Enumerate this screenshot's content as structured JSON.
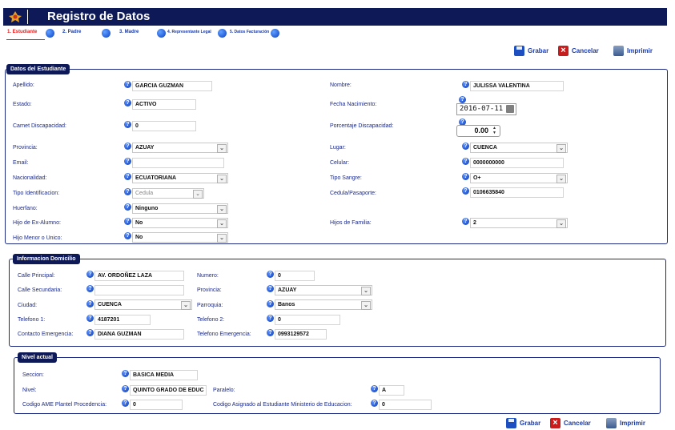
{
  "app": {
    "title": "Registro de Datos"
  },
  "steps": [
    {
      "label": "1. Estudiante"
    },
    {
      "label": "2. Padre"
    },
    {
      "label": "3. Madre"
    },
    {
      "label": "4. Representante Legal"
    },
    {
      "label": "5. Datos Facturación"
    }
  ],
  "toolbar": {
    "save_label": "Grabar",
    "cancel_label": "Cancelar",
    "print_label": "Imprimir"
  },
  "student": {
    "legend": "Datos del Estudiante",
    "apellido_label": "Apellido:",
    "apellido_value": "GARCIA GUZMAN",
    "nombre_label": "Nombre:",
    "nombre_value": "JULISSA VALENTINA",
    "estado_label": "Estado:",
    "estado_value": "ACTIVO",
    "fecha_label": "Fecha Nacimiento:",
    "fecha_value": "2016-07-11",
    "carnet_label": "Carnet Discapacidad:",
    "carnet_value": "0",
    "porcentaje_label": "Porcentaje Discapacidad:",
    "porcentaje_value": "0.00",
    "provincia_label": "Provincia:",
    "provincia_value": "AZUAY",
    "lugar_label": "Lugar:",
    "lugar_value": "CUENCA",
    "email_label": "Email:",
    "email_value": "",
    "celular_label": "Celular:",
    "celular_value": "0000000000",
    "nacionalidad_label": "Nacionalidad:",
    "nacionalidad_value": "ECUATORIANA",
    "tipo_sangre_label": "Tipo Sangre:",
    "tipo_sangre_value": "O+",
    "tipo_id_label": "Tipo Identificacion:",
    "tipo_id_value": "Cedula",
    "cedula_label": "Cedula/Pasaporte:",
    "cedula_value": "0106635840",
    "huerfano_label": "Huerfano:",
    "huerfano_value": "Ninguno",
    "hijo_exalumno_label": "Hijo de Ex-Alumno:",
    "hijo_exalumno_value": "No",
    "hijos_familia_label": "Hijos de Familia:",
    "hijos_familia_value": "2",
    "hijo_menor_label": "Hijo Menor o Unico:",
    "hijo_menor_value": "No"
  },
  "domicilio": {
    "legend": "Informacion Domicilio",
    "calle_principal_label": "Calle Principal:",
    "calle_principal_value": "AV. ORDOÑEZ LAZA",
    "numero_label": "Numero:",
    "numero_value": "0",
    "calle_secundaria_label": "Calle Secundaria:",
    "calle_secundaria_value": "",
    "provincia_label": "Provincia:",
    "provincia_value": "AZUAY",
    "ciudad_label": "Ciudad:",
    "ciudad_value": "CUENCA",
    "parroquia_label": "Parroquia:",
    "parroquia_value": "Banos",
    "telefono1_label": "Telefono 1:",
    "telefono1_value": "4187201",
    "telefono2_label": "Telefono 2:",
    "telefono2_value": "0",
    "contacto_label": "Contacto Emergencia:",
    "contacto_value": "DIANA GUZMAN",
    "telefono_emergencia_label": "Telefono Emergencia:",
    "telefono_emergencia_value": "0993129572"
  },
  "nivel": {
    "legend": "Nivel actual",
    "seccion_label": "Seccion:",
    "seccion_value": "BASICA MEDIA",
    "nivel_label": "Nivel:",
    "nivel_value": "QUINTO GRADO DE EDUC",
    "paralelo_label": "Paralelo:",
    "paralelo_value": "A",
    "codigo_ame_label": "Codigo AME Plantel Procedencia:",
    "codigo_ame_value": "0",
    "codigo_asignado_label": "Codigo Asignado al Estudiante Ministerio de Educacion:",
    "codigo_asignado_value": "0"
  },
  "colors": {
    "header_bg": "#0e1a58",
    "label_text": "#1a2a8c",
    "active_step": "#e02020",
    "help_icon": "#0c3ab0"
  },
  "icons": {
    "help": "question-circle-icon",
    "save": "floppy-disk-icon",
    "cancel": "red-x-icon",
    "print": "printer-icon"
  },
  "help_glyph": "?"
}
